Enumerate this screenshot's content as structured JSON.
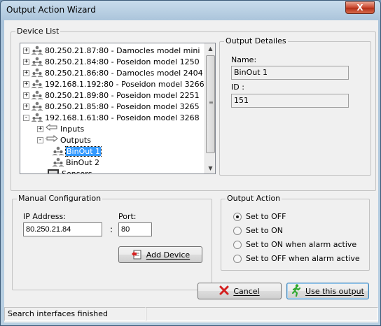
{
  "window": {
    "title": "Output Action Wizard",
    "close_glyph": "X"
  },
  "device_list": {
    "legend": "Device List",
    "items": [
      {
        "label": "80.250.21.87:80 - Damocles model mini",
        "expander": "+"
      },
      {
        "label": "80.250.21.84:80 - Poseidon model 1250",
        "expander": "+"
      },
      {
        "label": "80.250.21.86:80 - Damocles model 2404",
        "expander": "+"
      },
      {
        "label": "192.168.1.192:80 - Poseidon model 3266",
        "expander": "+"
      },
      {
        "label": "80.250.21.89:80 - Poseidon model 2251",
        "expander": "+"
      },
      {
        "label": "80.250.21.85:80 - Poseidon model 3265",
        "expander": "+"
      },
      {
        "label": "192.168.1.61:80 - Poseidon model 3268",
        "expander": "-"
      },
      {
        "label": "Inputs",
        "expander": "+"
      },
      {
        "label": "Outputs",
        "expander": "-"
      },
      {
        "label": "BinOut 1",
        "selected": true
      },
      {
        "label": "BinOut 2"
      },
      {
        "label": "Sensors"
      }
    ]
  },
  "output_details": {
    "legend": "Output Detailes",
    "name_label": "Name:",
    "name_value": "BinOut 1",
    "id_label": "ID :",
    "id_value": "151"
  },
  "manual_config": {
    "legend": "Manual Configuration",
    "ip_label": "IP Address:",
    "ip_value": "80.250.21.84",
    "separator": ":",
    "port_label": "Port:",
    "port_value": "80",
    "add_device_label": "Add Device"
  },
  "output_action": {
    "legend": "Output Action",
    "options": [
      {
        "label": "Set to OFF",
        "checked": true
      },
      {
        "label": "Set to ON",
        "checked": false
      },
      {
        "label": "Set to ON when alarm active",
        "checked": false
      },
      {
        "label": "Set to OFF when alarm active",
        "checked": false
      }
    ]
  },
  "buttons": {
    "cancel_label": "Cancel",
    "use_output_label": "Use this output"
  },
  "status": {
    "text": "Search interfaces finished"
  },
  "colors": {
    "selection": "#3399ff",
    "cancel_icon": "#d42020",
    "use_icon": "#2fa82f"
  }
}
